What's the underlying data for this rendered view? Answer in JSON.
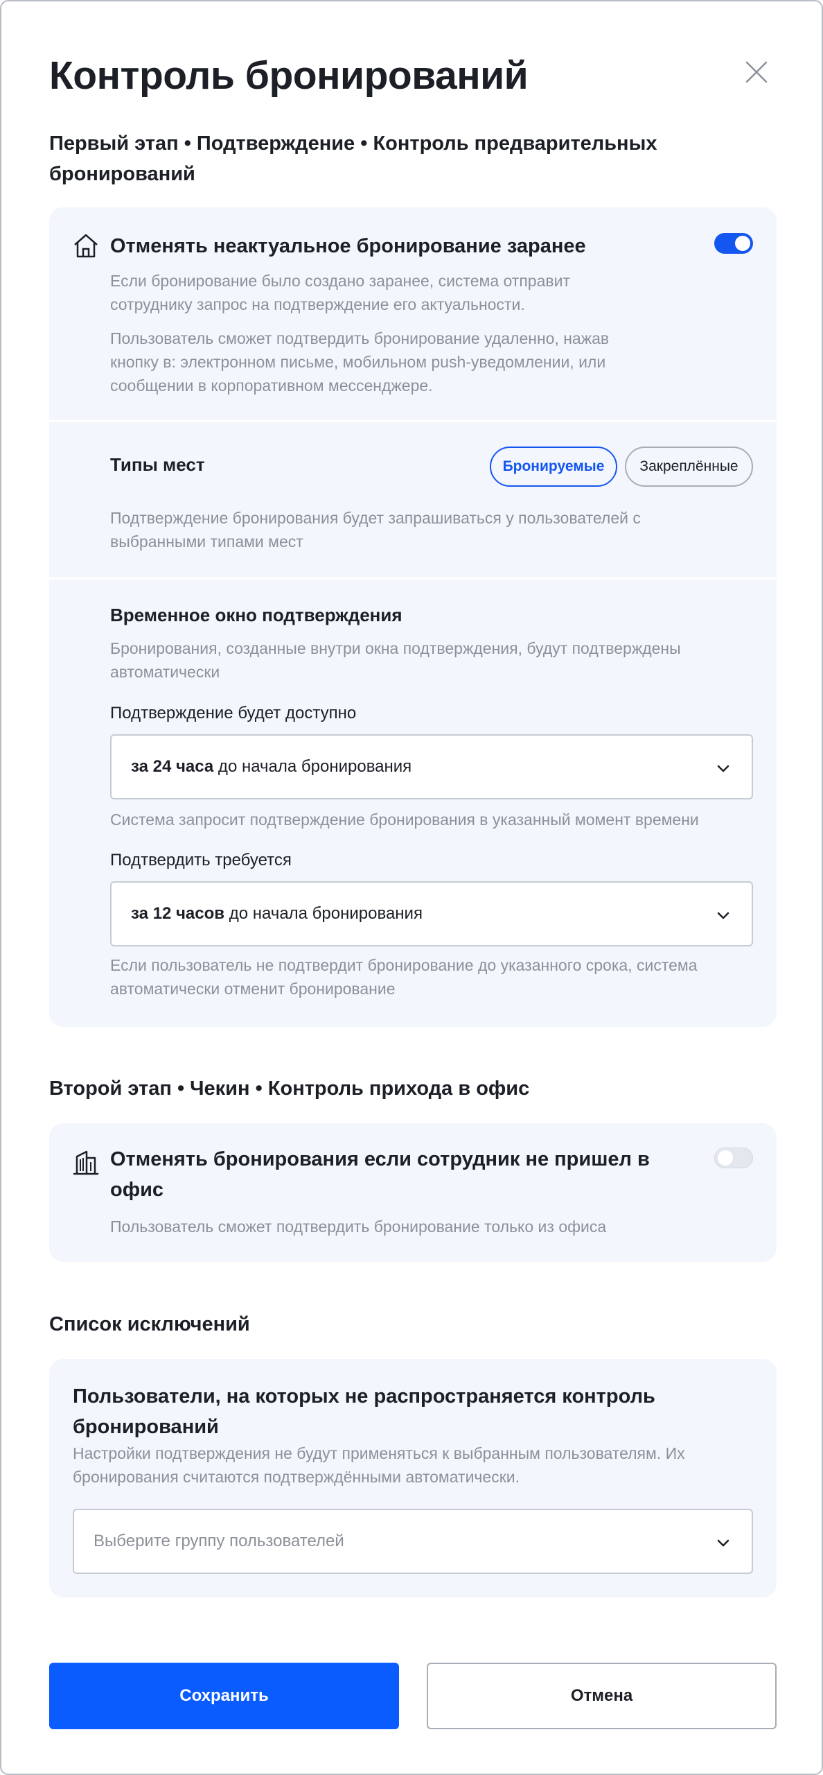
{
  "dialog": {
    "title": "Контроль бронирований"
  },
  "stage1": {
    "heading_line1": "Первый этап • Подтверждение • Контроль предварительных",
    "heading_line2": "бронирований",
    "setting": {
      "title": "Отменять неактуальное бронирование заранее",
      "enabled": true,
      "desc1_line1": "Если бронирование было создано заранее, система отправит",
      "desc1_line2": "сотруднику запрос на подтверждение его актуальности.",
      "desc2_line1": "Пользователь сможет подтвердить бронирование удаленно, нажав",
      "desc2_line2": "кнопку в: электронном письме, мобильном push-уведомлении, или",
      "desc2_line3": "сообщении в корпоративном мессенджере."
    },
    "seat_types": {
      "title": "Типы мест",
      "chip_bookable": "Бронируемые",
      "chip_fixed": "Закреплённые",
      "desc_line1": "Подтверждение бронирования будет запрашиваться у пользователей с",
      "desc_line2": "выбранными типами мест"
    },
    "window": {
      "title": "Временное окно подтверждения",
      "desc_line1": "Бронирования, созданные внутри окна подтверждения, будут подтверждены",
      "desc_line2": "автоматически",
      "available_label": "Подтверждение будет доступно",
      "available_strong": "за 24 часа",
      "available_rest": " до начала бронирования",
      "available_hint": "Система запросит подтверждение бронирования в указанный момент времени",
      "required_label": "Подтвердить требуется",
      "required_strong": "за 12 часов",
      "required_rest": " до начала бронирования",
      "required_hint_line1": "Если пользователь не подтвердит бронирование до указанного срока, система",
      "required_hint_line2": "автоматически отменит бронирование"
    }
  },
  "stage2": {
    "heading": "Второй этап • Чекин • Контроль прихода в офис",
    "setting": {
      "title_line1": "Отменять бронирования если сотрудник не пришел в",
      "title_line2": "офис",
      "enabled": false,
      "desc": "Пользователь сможет подтвердить бронирование только из офиса"
    }
  },
  "exceptions": {
    "heading": "Список исключений",
    "title_line1": "Пользователи, на которых не распространяется контроль",
    "title_line2": "бронирований",
    "desc_line1": "Настройки подтверждения не будут применяться к выбранным пользователям. Их",
    "desc_line2": "бронирования считаются подтверждёнными автоматически.",
    "select_placeholder": "Выберите группу пользователей"
  },
  "footer": {
    "save_label": "Сохранить",
    "cancel_label": "Отмена"
  },
  "colors": {
    "accent": "#0a5cff",
    "toggle_on": "#1456f0",
    "card_bg": "#f3f6fd",
    "muted_text": "#8c9099"
  },
  "icons": {
    "close": "close-icon",
    "home": "home-icon",
    "building": "building-icon",
    "chevron": "chevron-down-icon"
  }
}
